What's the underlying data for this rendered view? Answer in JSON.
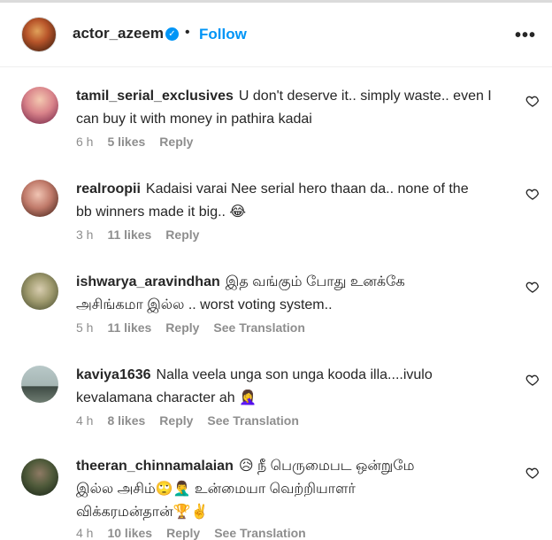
{
  "post_header": {
    "username": "actor_azeem",
    "separator": "•",
    "follow_label": "Follow",
    "more_label": "•••"
  },
  "comments": [
    {
      "username": "tamil_serial_exclusives",
      "text_line1": "U don't deserve it.. simply waste.. even I",
      "text_line2": "can buy it with money in pathira kadai",
      "time": "6 h",
      "likes": "5 likes",
      "reply": "Reply",
      "translation": ""
    },
    {
      "username": "realroopii",
      "text_line1": "Kadaisi varai Nee serial hero thaan da.. none of the",
      "text_line2": "bb winners made it big.. 😂",
      "time": "3 h",
      "likes": "11 likes",
      "reply": "Reply",
      "translation": ""
    },
    {
      "username": "ishwarya_aravindhan",
      "text_line1": "இத வங்கும் போது உனக்கே",
      "text_line2": "அசிங்கமா இல்ல .. worst voting system..",
      "time": "5 h",
      "likes": "11 likes",
      "reply": "Reply",
      "translation": "See Translation"
    },
    {
      "username": "kaviya1636",
      "text_line1": "Nalla veela unga son unga kooda illa....ivulo",
      "text_line2": "kevalamana character ah 🤦‍♀️",
      "time": "4 h",
      "likes": "8 likes",
      "reply": "Reply",
      "translation": "See Translation"
    },
    {
      "username": "theeran_chinnamalaian",
      "text_line1": "😥 நீ பெருமைபட ஒன்றுமே",
      "text_line2": "இல்ல அசிம்🙄🤦‍♂️ உன்மையா வெற்றியாளர்",
      "text_line3": "விக்கரமன்தான்🏆✌️",
      "time": "4 h",
      "likes": "10 likes",
      "reply": "Reply",
      "translation": "See Translation"
    }
  ],
  "colors": {
    "accent": "#0095f6",
    "text": "#262626",
    "muted": "#8e8e8e"
  },
  "icons": [
    "verified-badge-icon",
    "more-options-icon",
    "heart-icon"
  ]
}
